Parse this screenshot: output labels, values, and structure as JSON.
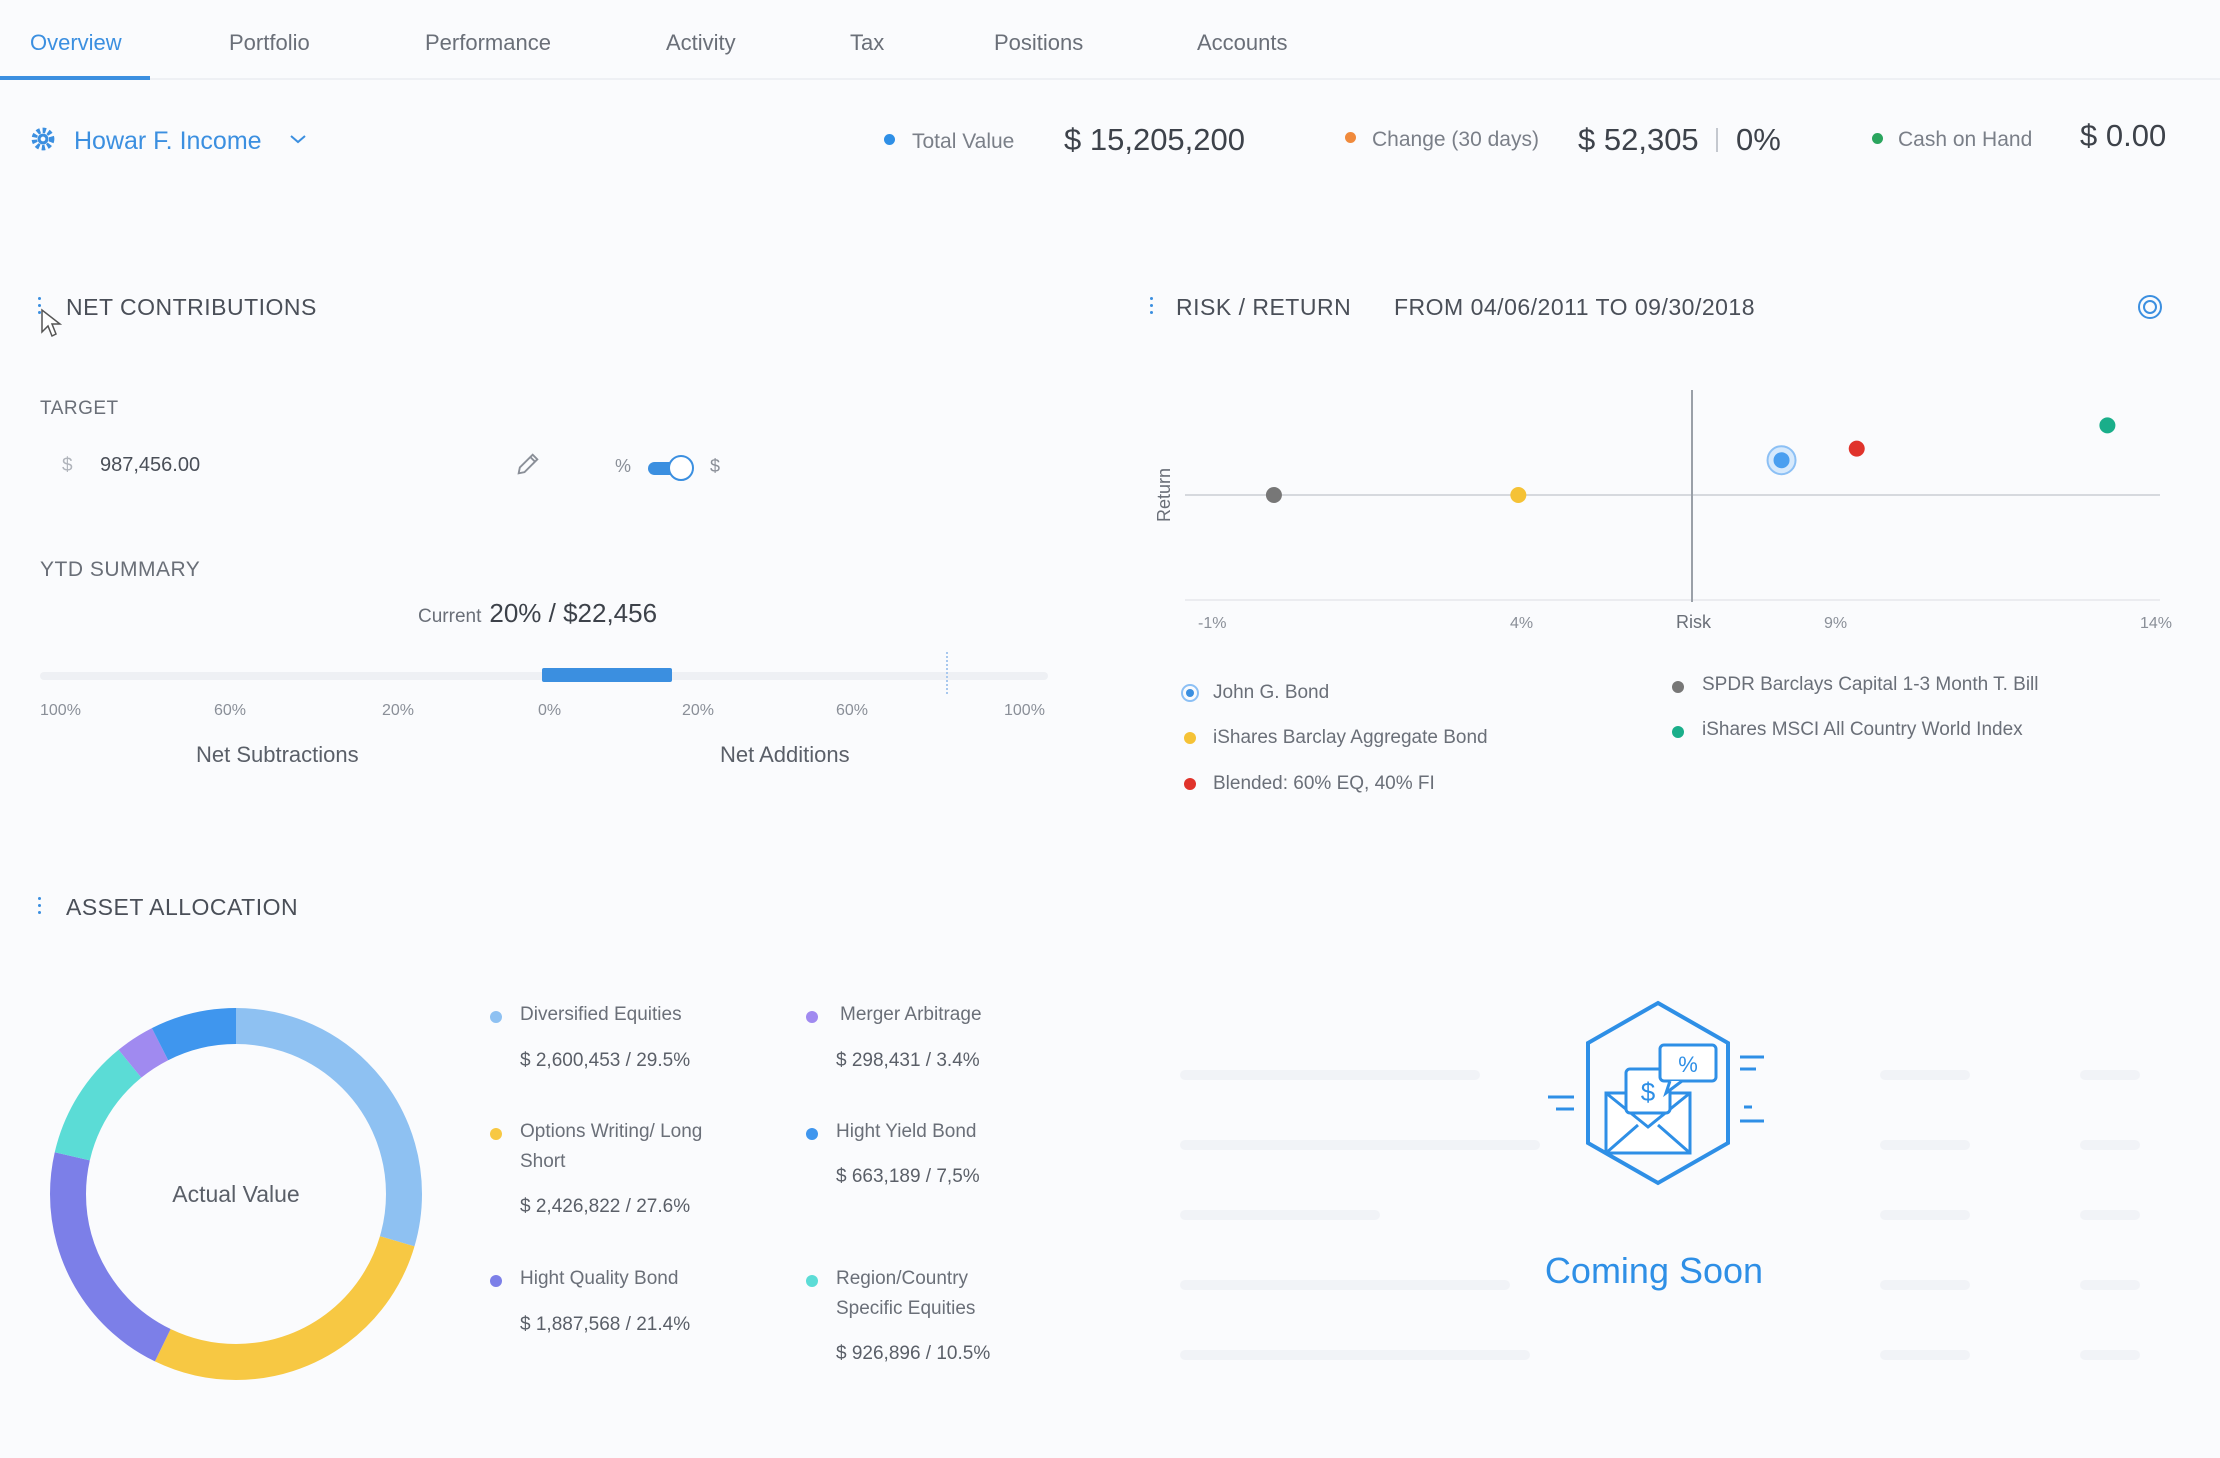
{
  "tabs": [
    {
      "label": "Overview",
      "active": true
    },
    {
      "label": "Portfolio"
    },
    {
      "label": "Performance"
    },
    {
      "label": "Activity"
    },
    {
      "label": "Tax"
    },
    {
      "label": "Positions"
    },
    {
      "label": "Accounts"
    }
  ],
  "account": {
    "name": "Howar F. Income",
    "icon": "gear-icon",
    "dropdown_icon": "chevron-down-icon"
  },
  "stats": {
    "total_value": {
      "label": "Total Value",
      "value": "$ 15,205,200",
      "color": "#2e8fe6"
    },
    "change": {
      "label": "Change (30 days)",
      "value": "$ 52,305",
      "pct": "0%",
      "color": "#f08a3c"
    },
    "cash": {
      "label": "Cash on Hand",
      "value": "$ 0.00",
      "color": "#2aa55e"
    }
  },
  "net_contributions": {
    "title": "NET CONTRIBUTIONS",
    "target_label": "TARGET",
    "target_currency": "$",
    "target_value": "987,456.00",
    "toggle_left": "%",
    "toggle_right": "$",
    "ytd_label": "YTD SUMMARY",
    "current_prefix": "Current",
    "current_value": "20% / $22,456",
    "current_fraction": 0.2,
    "ticks": [
      "100%",
      "60%",
      "20%",
      "0%",
      "20%",
      "60%",
      "100%"
    ],
    "subtractions_label": "Net Subtractions",
    "additions_label": "Net Additions"
  },
  "risk_return": {
    "title": "RISK / RETURN",
    "range": "FROM 04/06/2011 TO 09/30/2018",
    "settings_icon": "target-icon"
  },
  "chart_data": {
    "type": "scatter",
    "xlabel": "Risk",
    "ylabel": "Return",
    "x_ticks": [
      "-1%",
      "4%",
      "Risk",
      "9%",
      "14%"
    ],
    "xlim": [
      -1,
      14
    ],
    "series": [
      {
        "name": "John G. Bond",
        "x": 8.2,
        "y": 0.6,
        "color": "#4a9ff0",
        "marker": "ring"
      },
      {
        "name": "SPDR Barclays Capital 1-3 Month T. Bill",
        "x": 0.1,
        "y": 0.0,
        "color": "#777777"
      },
      {
        "name": "iShares Barclay Aggregate Bond",
        "x": 4.0,
        "y": 0.0,
        "color": "#f5c236"
      },
      {
        "name": "iShares MSCI All Country World Index",
        "x": 13.4,
        "y": 1.2,
        "color": "#1aae8a"
      },
      {
        "name": "Blended: 60% EQ, 40% FI",
        "x": 9.4,
        "y": 0.8,
        "color": "#e0332b"
      }
    ],
    "legend_labels": {
      "john": "John G. Bond",
      "spdr": "SPDR Barclays Capital 1-3 Month T. Bill",
      "agg": "iShares Barclay Aggregate Bond",
      "msci": "iShares MSCI All Country World Index",
      "blend": "Blended: 60% EQ, 40% FI"
    }
  },
  "asset_allocation": {
    "title": "ASSET ALLOCATION",
    "donut_label": "Actual Value",
    "items": [
      {
        "name": "Diversified Equities",
        "value": "$ 2,600,453 / 29.5%",
        "pct": 29.5,
        "color": "#8ec1f2"
      },
      {
        "name": "Options Writing/ Long Short",
        "value": "$ 2,426,822 / 27.6%",
        "pct": 27.6,
        "color": "#f7c843"
      },
      {
        "name": "Hight Quality Bond",
        "value": "$ 1,887,568 / 21.4%",
        "pct": 21.4,
        "color": "#7c7fe8"
      },
      {
        "name": "Merger Arbitrage",
        "value": "$ 298,431 / 3.4%",
        "pct": 3.4,
        "color": "#a08af0"
      },
      {
        "name": "Hight Yield Bond",
        "value": "$ 663,189 / 7,5%",
        "pct": 7.5,
        "color": "#3f96ee"
      },
      {
        "name": "Region/Country Specific Equities",
        "value": "$ 926,896 / 10.5%",
        "pct": 10.5,
        "color": "#5bdcd6"
      }
    ]
  },
  "coming_soon": {
    "label": "Coming Soon",
    "icon": "money-envelope-icon"
  }
}
